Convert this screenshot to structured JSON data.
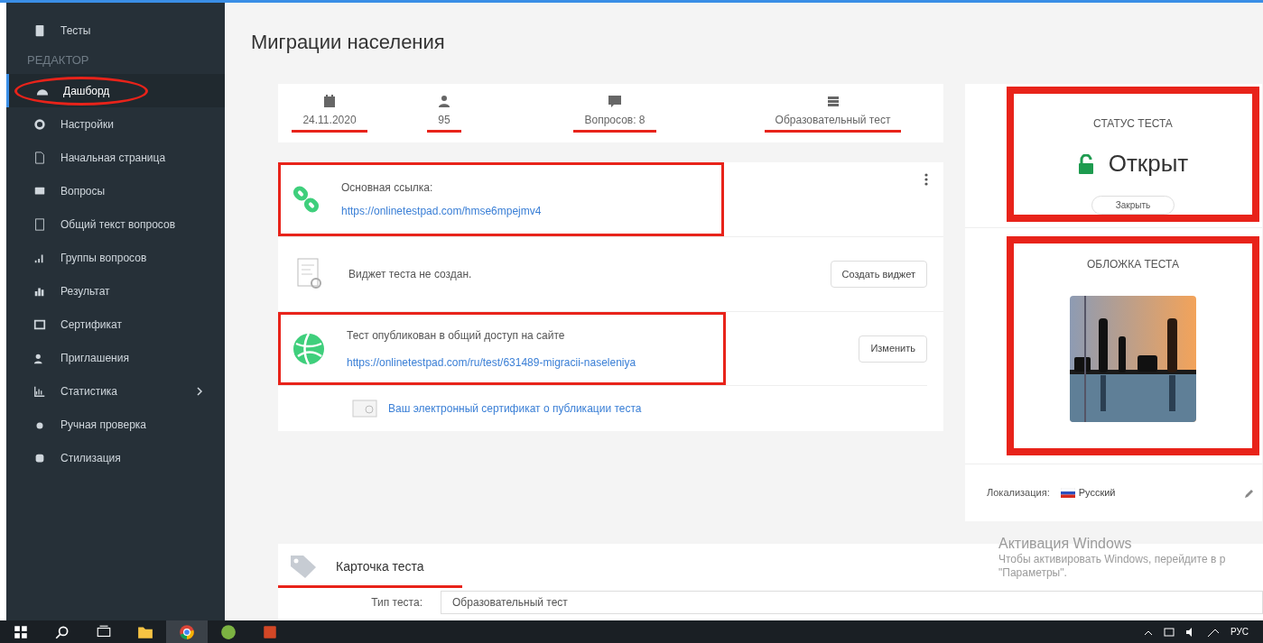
{
  "sidebar": {
    "items": [
      {
        "label": "Тесты",
        "selected": false,
        "circled": false
      },
      {
        "kind": "header",
        "label": "РЕДАКТОР"
      },
      {
        "label": "Дашборд",
        "selected": true,
        "circled": true
      },
      {
        "label": "Настройки",
        "selected": false,
        "circled": false
      },
      {
        "label": "Начальная страница",
        "selected": false,
        "circled": false
      },
      {
        "label": "Вопросы",
        "selected": false,
        "circled": false
      },
      {
        "label": "Общий текст вопросов",
        "selected": false,
        "circled": false
      },
      {
        "label": "Группы вопросов",
        "selected": false,
        "circled": false
      },
      {
        "label": "Результат",
        "selected": false,
        "circled": false
      },
      {
        "label": "Сертификат",
        "selected": false,
        "circled": false
      },
      {
        "label": "Приглашения",
        "selected": false,
        "circled": false
      },
      {
        "label": "Статистика",
        "selected": false,
        "circled": false,
        "expandable": true
      },
      {
        "label": "Ручная проверка",
        "selected": false,
        "circled": false
      },
      {
        "label": "Стилизация",
        "selected": false,
        "circled": false
      }
    ]
  },
  "page_title": "Миграции населения",
  "stats": [
    {
      "value": "24.11.2020",
      "underlined": true
    },
    {
      "value": "95",
      "underlined": true
    },
    {
      "value": "Вопросов: 8",
      "underlined": true
    },
    {
      "value": "Образовательный тест",
      "underlined": true
    }
  ],
  "links": [
    {
      "kind": "link",
      "label": "Основная ссылка:",
      "url": "https://onlinetestpad.com/hmse6mpejmv4",
      "highlighted": true
    },
    {
      "kind": "widget",
      "label": "Виджет теста не создан.",
      "button": "Создать виджет",
      "highlighted": false
    },
    {
      "kind": "published",
      "label": "Тест опубликован в общий доступ на сайте",
      "url": "https://onlinetestpad.com/ru/test/631489-migracii-naseleniya",
      "button": "Изменить",
      "highlighted": true
    },
    {
      "kind": "certificate",
      "url": "Ваш электронный сертификат о публикации теста",
      "highlighted": false
    }
  ],
  "status": {
    "title": "СТАТУС ТЕСТА",
    "value": "Открыт",
    "open": true,
    "button": "Закрыть",
    "highlighted": true
  },
  "cover": {
    "title": "ОБЛОЖКА ТЕСТА",
    "highlighted": true
  },
  "localization": {
    "label": "Локализация:",
    "value": "Русский"
  },
  "test_card": {
    "title": "Карточка теста",
    "underlined": true,
    "fields": [
      {
        "label": "Тип теста:",
        "value": "Образовательный тест"
      }
    ]
  },
  "activation": {
    "title": "Активация Windows",
    "text": "Чтобы активировать Windows, перейдите в р",
    "text2": "\"Параметры\"."
  },
  "taskbar": {
    "apps": [
      {
        "active": false
      },
      {
        "active": false
      },
      {
        "active": false
      },
      {
        "active": false
      },
      {
        "active": true
      },
      {
        "active": false
      },
      {
        "active": false
      }
    ],
    "lang": "РУС"
  }
}
